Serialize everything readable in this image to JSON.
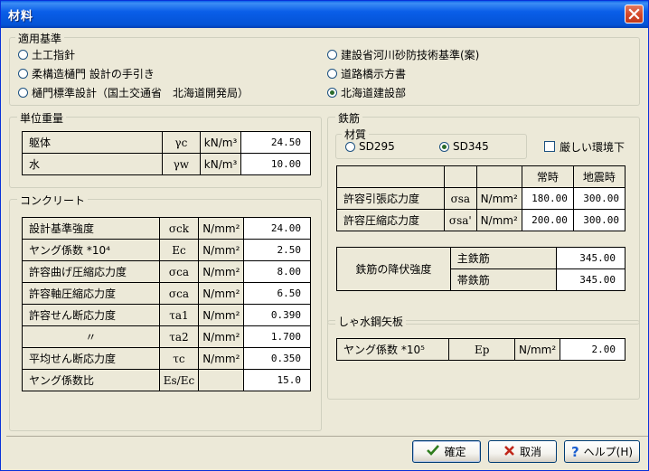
{
  "window": {
    "title": "材料"
  },
  "standards": {
    "group_title": "適用基準",
    "options": [
      {
        "label": "土工指針",
        "selected": false
      },
      {
        "label": "柔構造樋門 設計の手引き",
        "selected": false
      },
      {
        "label": "樋門標準設計（国土交通省　北海道開発局）",
        "selected": false
      },
      {
        "label": "建設省河川砂防技術基準(案)",
        "selected": false
      },
      {
        "label": "道路橋示方書",
        "selected": false
      },
      {
        "label": "北海道建設部",
        "selected": true
      }
    ]
  },
  "unit_weight": {
    "group_title": "単位重量",
    "rows": [
      {
        "name": "躯体",
        "symbol": "γc",
        "unit": "kN/m³",
        "value": "24.50"
      },
      {
        "name": "水",
        "symbol": "γw",
        "unit": "kN/m³",
        "value": "10.00"
      }
    ]
  },
  "concrete": {
    "group_title": "コンクリート",
    "rows": [
      {
        "name": "設計基準強度",
        "symbol": "σck",
        "unit": "N/mm²",
        "value": "24.00"
      },
      {
        "name": "ヤング係数 *10⁴",
        "symbol": "Ec",
        "unit": "N/mm²",
        "value": "2.50"
      },
      {
        "name": "許容曲げ圧縮応力度",
        "symbol": "σca",
        "unit": "N/mm²",
        "value": "8.00"
      },
      {
        "name": "許容軸圧縮応力度",
        "symbol": "σca",
        "unit": "N/mm²",
        "value": "6.50"
      },
      {
        "name": "許容せん断応力度",
        "symbol": "τa1",
        "unit": "N/mm²",
        "value": "0.390"
      },
      {
        "name": "〃",
        "symbol": "τa2",
        "unit": "N/mm²",
        "value": "1.700"
      },
      {
        "name": "平均せん断応力度",
        "symbol": "τc",
        "unit": "N/mm²",
        "value": "0.350"
      },
      {
        "name": "ヤング係数比",
        "symbol": "Es/Ec",
        "unit": "",
        "value": "15.0"
      }
    ]
  },
  "rebar": {
    "group_title": "鉄筋",
    "material_label": "材質",
    "materials": [
      {
        "label": "SD295",
        "selected": false
      },
      {
        "label": "SD345",
        "selected": true
      }
    ],
    "harsh_env_label": "厳しい環境下",
    "harsh_env_checked": false,
    "headers": [
      "常時",
      "地震時"
    ],
    "rows": [
      {
        "name": "許容引張応力度",
        "symbol": "σsa",
        "unit": "N/mm²",
        "normal": "180.00",
        "seismic": "300.00"
      },
      {
        "name": "許容圧縮応力度",
        "symbol": "σsa'",
        "unit": "N/mm²",
        "normal": "200.00",
        "seismic": "300.00"
      }
    ],
    "yield_label": "鉄筋の降伏強度",
    "yield_rows": [
      {
        "name": "主鉄筋",
        "value": "345.00"
      },
      {
        "name": "帯鉄筋",
        "value": "345.00"
      }
    ]
  },
  "sheet_pile": {
    "group_title": "しゃ水鋼矢板",
    "row": {
      "name": "ヤング係数 *10⁵",
      "symbol": "Ep",
      "unit": "N/mm²",
      "value": "2.00"
    }
  },
  "buttons": {
    "ok": "確定",
    "cancel": "取消",
    "help": "ヘルプ(H)"
  },
  "colors": {
    "title_bar": "#0a5ee8",
    "ok_icon": "#2f7d1e",
    "cancel_icon": "#c0261a",
    "help_icon": "#1c5fd0"
  }
}
